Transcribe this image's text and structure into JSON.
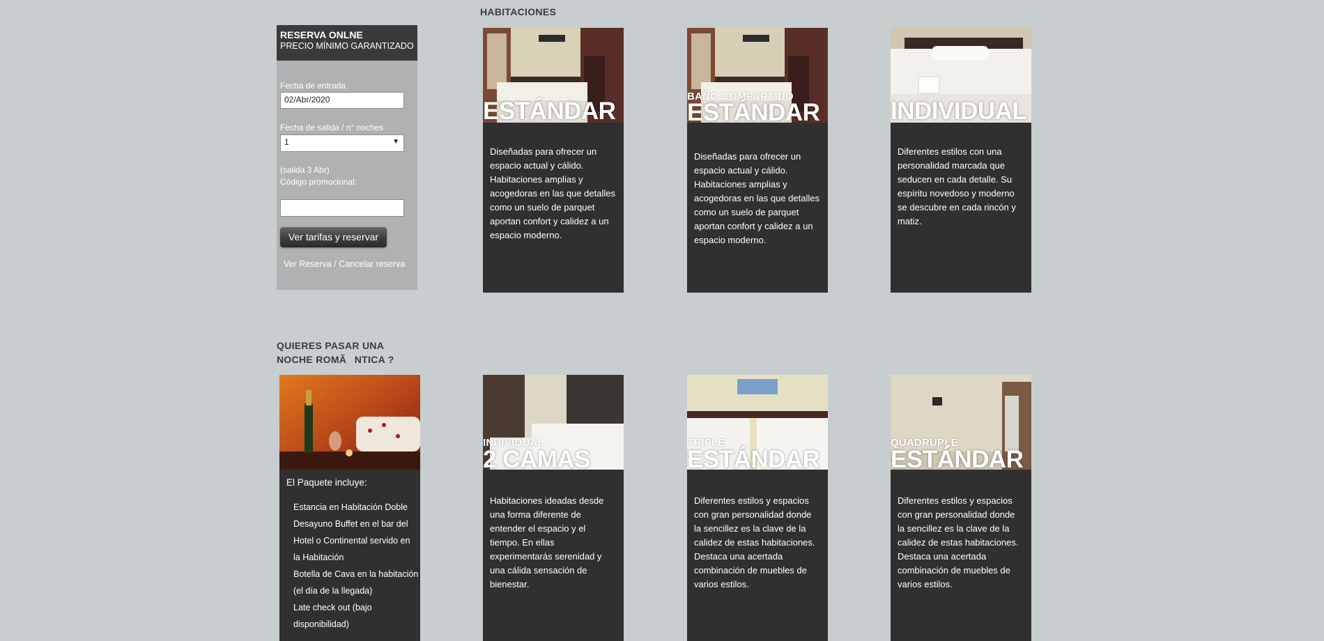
{
  "sections": {
    "rooms_title": "HABITACIONES",
    "romantic_title_line1": "QUIERES PASAR UNA",
    "romantic_title_line2": "NOCHE ROMÃNTICA ?"
  },
  "booking": {
    "title": "RESERVA ONLNE",
    "subtitle": "PRECIO MÍNIMO GARANTIZADO",
    "checkin_label": "Fecha de entrada",
    "checkin_value": "02/Abr/2020",
    "checkout_label": "Fecha de salida / n° noches",
    "nights_value": "1",
    "checkout_note": "(salida 3 Abr)",
    "promo_label": "Código promocional:",
    "promo_value": "",
    "submit_label": "Ver tarifas y reservar",
    "manage_link": "Ver Reserva / Cancelar reserva"
  },
  "rooms": [
    {
      "sub": "",
      "name": "ESTÁNDAR",
      "description": "Diseñadas para ofrecer un espacio actual y cálido. Habitaciones amplias y acogedoras en las que detalles como un suelo de parquet aportan confort y calidez a un espacio moderno."
    },
    {
      "sub": "BAÑO COMPARTIDO",
      "name": "ESTÁNDAR",
      "description": "Diseñadas para ofrecer un espacio actual y cálido. Habitaciones amplias y acogedoras en las que detalles como un suelo de parquet aportan confort y calidez a un espacio moderno."
    },
    {
      "sub": "",
      "name": "INDIVIDUAL",
      "description": "Diferentes estilos con una personalidad marcada que seducen en cada detalle. Su espíritu novedoso y moderno se descubre en cada rincón y matiz."
    },
    {
      "sub": "INDIVIDUAL",
      "name": "2 CAMAS",
      "description": "Habitaciones ideadas desde una forma diferente de entender el espacio y el tiempo. En ellas experimentarás serenidad y una cálida sensación de bienestar."
    },
    {
      "sub": "TRIPLE",
      "name": "ESTÁNDAR",
      "description": "Diferentes estilos y espacios con gran personalidad donde la sencillez es la clave de la calidez de estas habitaciones. Destaca una acertada combinación de muebles de varios estilos."
    },
    {
      "sub": "QUADRUPLE",
      "name": "ESTÁNDAR",
      "description": "Diferentes estilos y espacios con gran personalidad donde la sencillez es la clave de la calidez de estas habitaciones. Destaca una acertada combinación de muebles de varios estilos."
    }
  ],
  "romantic_package": {
    "title": "El Paquete incluye:",
    "items": [
      "Estancia en Habitación Doble",
      "Desayuno Buffet en el bar del Hotel o Continental servido en la Habitación",
      "Botella de Cava en la habitación (el día de la llegada)",
      "Late check out (bajo disponibilidad)"
    ]
  },
  "colors": {
    "page_bg": "#c8cecf",
    "card_bg": "#303030",
    "booking_bg": "#b0b1b2",
    "booking_header_bg": "#3a3a3a"
  }
}
